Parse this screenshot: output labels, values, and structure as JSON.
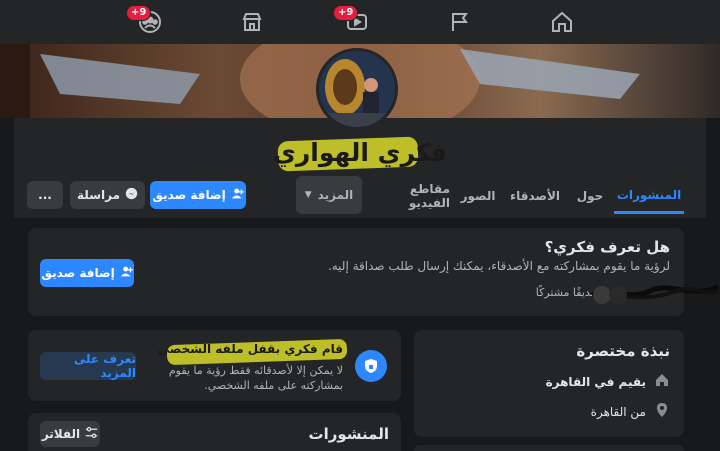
{
  "topnav": {
    "badges": {
      "watch": "+9",
      "groups": "+9"
    }
  },
  "profile": {
    "name": "فكري الهواري"
  },
  "tabs": [
    {
      "label": "المنشورات"
    },
    {
      "label": "حول"
    },
    {
      "label": "الأصدقاء"
    },
    {
      "label": "الصور"
    },
    {
      "label": "مقاطع الفيديو"
    },
    {
      "label": "المزيد"
    }
  ],
  "actions": {
    "add_friend": "إضافة صديق",
    "message": "مراسلة",
    "more_options": "..."
  },
  "know_card": {
    "title": "هل تعرف فكري؟",
    "subtitle": "لرؤية ما يقوم بمشاركته مع الأصدقاء، يمكنك إرسال طلب صداقة إليه.",
    "mutual": "صديقًا مشتركًا",
    "add_friend": "إضافة صديق"
  },
  "locked_card": {
    "title": "قام فكري بقفل ملفه الشخصي",
    "body": "لا يمكن إلا لأصدقائه فقط رؤية ما يقوم بمشاركته على ملفه الشخصي.",
    "learn_more": "تعرف على المزيد"
  },
  "intro_card": {
    "title": "نبذة مختصرة",
    "lives_in": "يقيم في القاهرة",
    "from": "من القاهرة"
  },
  "posts_card": {
    "title": "المنشورات",
    "filters": "الفلاتر"
  },
  "colors": {
    "accent": "#2d88ff",
    "background": "#18191a",
    "card": "#242526",
    "highlight": "#d9d92a"
  }
}
